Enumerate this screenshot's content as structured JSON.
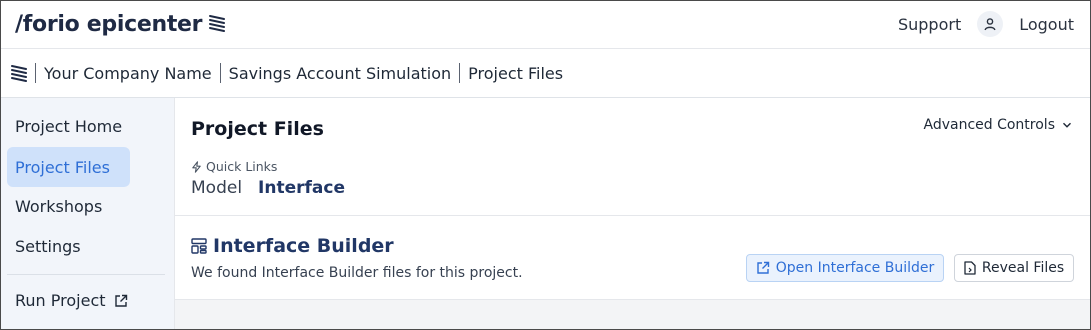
{
  "header": {
    "brand": "/forio epicenter",
    "support_label": "Support",
    "logout_label": "Logout"
  },
  "breadcrumb": {
    "items": [
      "Your Company Name",
      "Savings Account Simulation",
      "Project Files"
    ]
  },
  "sidebar": {
    "items": [
      {
        "label": "Project Home",
        "active": false
      },
      {
        "label": "Project Files",
        "active": true
      },
      {
        "label": "Workshops",
        "active": false
      },
      {
        "label": "Settings",
        "active": false
      }
    ],
    "run_project_label": "Run Project"
  },
  "main": {
    "title": "Project Files",
    "advanced_controls_label": "Advanced Controls",
    "quick_links": {
      "label": "Quick Links",
      "links": [
        "Model",
        "Interface"
      ]
    },
    "interface_builder": {
      "title": "Interface Builder",
      "description": "We found Interface Builder files for this project.",
      "open_button_label": "Open Interface Builder",
      "reveal_button_label": "Reveal Files"
    }
  },
  "icons": {
    "brand_logo": "epicenter-logo-icon",
    "user": "user-icon",
    "external_link": "external-link-icon",
    "chevron": "chevron-down-icon",
    "bolt": "bolt-icon",
    "layout": "layout-icon",
    "file": "file-icon"
  },
  "colors": {
    "accent": "#2f6fd6",
    "active_nav_bg": "#cfe1fa",
    "sidebar_bg": "#f2f5fa",
    "heading_navy": "#213766"
  }
}
